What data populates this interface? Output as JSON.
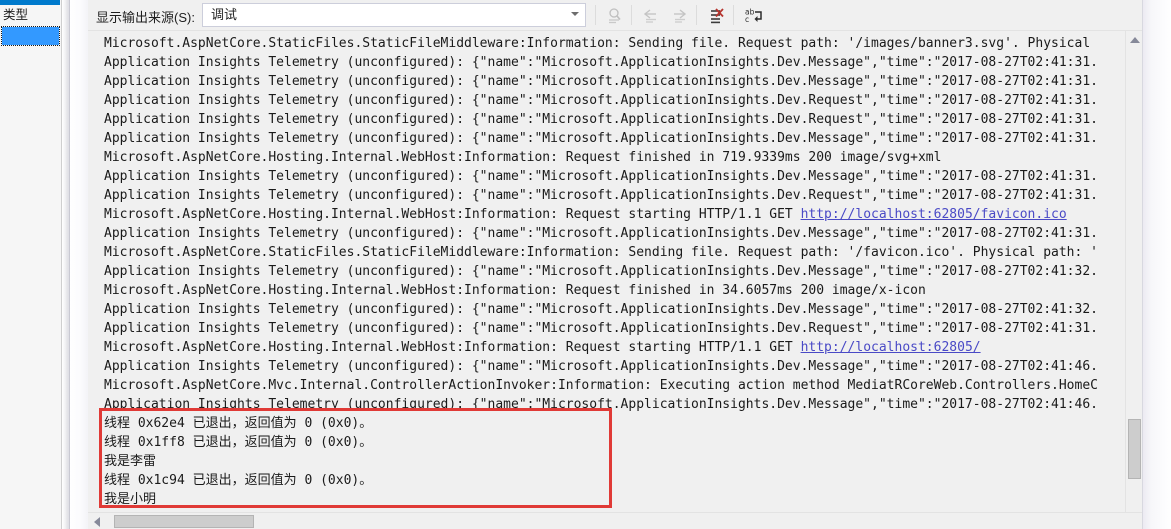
{
  "window": {
    "title": "Output",
    "accent_color": "#007acc"
  },
  "left_panel": {
    "header": "类型",
    "selected_row_color": "#3399ff"
  },
  "toolbar": {
    "source_label": "显示输出来源(S):",
    "source_value": "调试",
    "source_placeholder": "调试",
    "buttons": [
      {
        "name": "find-message-icon",
        "label": "查找消息",
        "enabled": false
      },
      {
        "name": "go-to-previous-message-icon",
        "label": "转到上一条消息",
        "enabled": false
      },
      {
        "name": "go-to-next-message-icon",
        "label": "转到下一条消息",
        "enabled": false
      },
      {
        "name": "clear-all-icon",
        "label": "全部清除",
        "enabled": true
      },
      {
        "name": "toggle-word-wrap-icon",
        "label": "切换自动换行",
        "enabled": true
      }
    ]
  },
  "output": {
    "link_color": "#4a4ac6",
    "lines": [
      {
        "text": "Microsoft.AspNetCore.StaticFiles.StaticFileMiddleware:Information: Sending file. Request path: '/images/banner3.svg'. Physical"
      },
      {
        "text": "Application Insights Telemetry (unconfigured): {\"name\":\"Microsoft.ApplicationInsights.Dev.Message\",\"time\":\"2017-08-27T02:41:31."
      },
      {
        "text": "Application Insights Telemetry (unconfigured): {\"name\":\"Microsoft.ApplicationInsights.Dev.Message\",\"time\":\"2017-08-27T02:41:31."
      },
      {
        "text": "Application Insights Telemetry (unconfigured): {\"name\":\"Microsoft.ApplicationInsights.Dev.Request\",\"time\":\"2017-08-27T02:41:31."
      },
      {
        "text": "Application Insights Telemetry (unconfigured): {\"name\":\"Microsoft.ApplicationInsights.Dev.Request\",\"time\":\"2017-08-27T02:41:31."
      },
      {
        "text": "Application Insights Telemetry (unconfigured): {\"name\":\"Microsoft.ApplicationInsights.Dev.Message\",\"time\":\"2017-08-27T02:41:31."
      },
      {
        "text": "Microsoft.AspNetCore.Hosting.Internal.WebHost:Information: Request finished in 719.9339ms 200 image/svg+xml"
      },
      {
        "text": "Application Insights Telemetry (unconfigured): {\"name\":\"Microsoft.ApplicationInsights.Dev.Message\",\"time\":\"2017-08-27T02:41:31."
      },
      {
        "text": "Application Insights Telemetry (unconfigured): {\"name\":\"Microsoft.ApplicationInsights.Dev.Request\",\"time\":\"2017-08-27T02:41:31."
      },
      {
        "text": "Microsoft.AspNetCore.Hosting.Internal.WebHost:Information: Request starting HTTP/1.1 GET ",
        "link": "http://localhost:62805/favicon.ico"
      },
      {
        "text": "Application Insights Telemetry (unconfigured): {\"name\":\"Microsoft.ApplicationInsights.Dev.Message\",\"time\":\"2017-08-27T02:41:31."
      },
      {
        "text": "Microsoft.AspNetCore.StaticFiles.StaticFileMiddleware:Information: Sending file. Request path: '/favicon.ico'. Physical path: '"
      },
      {
        "text": "Application Insights Telemetry (unconfigured): {\"name\":\"Microsoft.ApplicationInsights.Dev.Message\",\"time\":\"2017-08-27T02:41:32."
      },
      {
        "text": "Microsoft.AspNetCore.Hosting.Internal.WebHost:Information: Request finished in 34.6057ms 200 image/x-icon"
      },
      {
        "text": "Application Insights Telemetry (unconfigured): {\"name\":\"Microsoft.ApplicationInsights.Dev.Message\",\"time\":\"2017-08-27T02:41:32."
      },
      {
        "text": "Application Insights Telemetry (unconfigured): {\"name\":\"Microsoft.ApplicationInsights.Dev.Request\",\"time\":\"2017-08-27T02:41:31."
      },
      {
        "text": "Microsoft.AspNetCore.Hosting.Internal.WebHost:Information: Request starting HTTP/1.1 GET ",
        "link": "http://localhost:62805/"
      },
      {
        "text": "Application Insights Telemetry (unconfigured): {\"name\":\"Microsoft.ApplicationInsights.Dev.Message\",\"time\":\"2017-08-27T02:41:46."
      },
      {
        "text": "Microsoft.AspNetCore.Mvc.Internal.ControllerActionInvoker:Information: Executing action method MediatRCoreWeb.Controllers.HomeC"
      },
      {
        "text": "Application Insights Telemetry (unconfigured): {\"name\":\"Microsoft.ApplicationInsights.Dev.Message\",\"time\":\"2017-08-27T02:41:46."
      },
      {
        "text": "线程 0x62e4 已退出，返回值为 0 (0x0)。"
      },
      {
        "text": "线程 0x1ff8 已退出，返回值为 0 (0x0)。"
      },
      {
        "text": "我是李雷"
      },
      {
        "text": "线程 0x1c94 已退出，返回值为 0 (0x0)。"
      },
      {
        "text": "我是小明"
      }
    ]
  },
  "annotation": {
    "name": "red-highlight-box",
    "color": "#e03a36"
  },
  "scrollbars": {
    "vertical_thumb_color": "#cdcdcd",
    "horizontal_thumb_color": "#cdcdcd"
  }
}
